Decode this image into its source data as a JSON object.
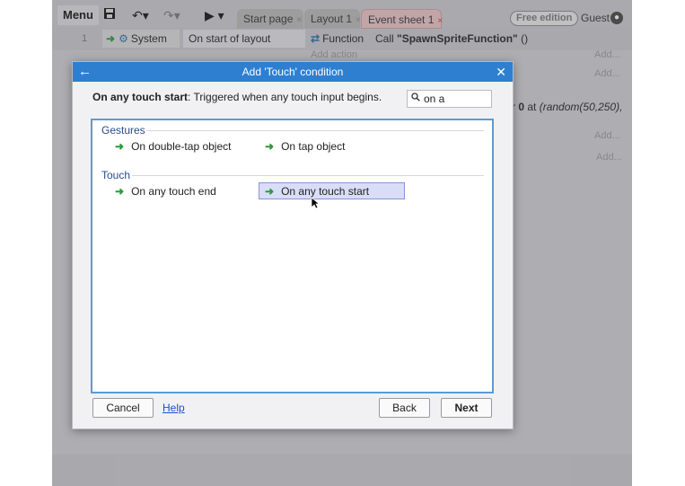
{
  "toolbar": {
    "menu_label": "Menu",
    "tabs": [
      {
        "label": "Start page"
      },
      {
        "label": "Layout 1"
      },
      {
        "label": "Event sheet 1"
      }
    ],
    "tab_close_glyph": "×",
    "free_badge": "Free edition",
    "user_label": "Guest"
  },
  "event_sheet": {
    "row_number": "1",
    "object": "System",
    "condition": "On start of layout",
    "action_object": "Function",
    "action_prefix": "Call ",
    "action_name": "\"SpawnSpriteFunction\"",
    "action_suffix": " ()",
    "add_action": "Add action",
    "add_labels": [
      "Add...",
      "Add...",
      "Add...",
      "Add..."
    ],
    "partial_text_prefix": "r ",
    "partial_text_bold": "0",
    "partial_text_mid": " at ",
    "partial_text_italic": "(random(50,250),"
  },
  "dialog": {
    "title": "Add 'Touch' condition",
    "description_bold": "On any touch start",
    "description_rest": ": Triggered when any touch input begins.",
    "search_value": "on a",
    "groups": [
      {
        "label": "Gestures",
        "items": [
          "On double-tap object",
          "On tap object"
        ]
      },
      {
        "label": "Touch",
        "items": [
          "On any touch end",
          "On any touch start"
        ]
      }
    ],
    "selected_item": "On any touch start",
    "buttons": {
      "cancel": "Cancel",
      "help": "Help",
      "back": "Back",
      "next": "Next"
    }
  },
  "colors": {
    "dialog_title_bar": "#2f7fd0",
    "selection": "#d9ddf8",
    "arrow": "#2a9a3a",
    "help_link": "#1a4fd0"
  },
  "icons": [
    "save-icon",
    "undo-icon",
    "redo-icon",
    "play-icon",
    "gear-icon",
    "function-icon",
    "back-arrow-icon",
    "close-icon",
    "search-icon",
    "user-icon",
    "pointer-cursor-icon"
  ]
}
